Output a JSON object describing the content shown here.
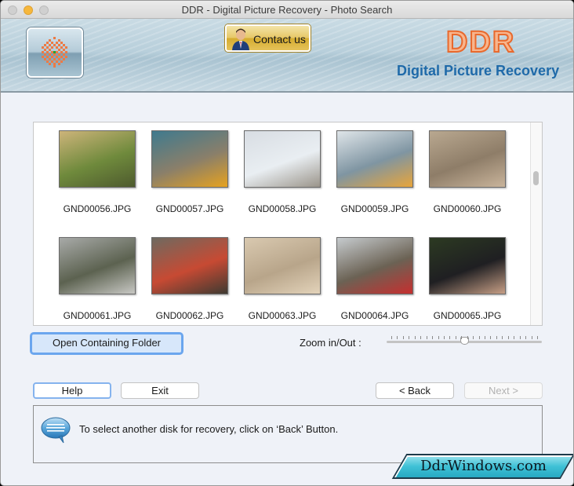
{
  "window": {
    "title": "DDR - Digital Picture Recovery - Photo Search"
  },
  "banner": {
    "contact_label": "Contact us",
    "brand": "DDR",
    "product": "Digital Picture Recovery",
    "brand_color": "#e8692d",
    "product_color": "#1f6aa9"
  },
  "gallery": {
    "items": [
      {
        "name": "GND00056.JPG",
        "colors": [
          "#cdb47a",
          "#6f8a3c",
          "#4e5a2e"
        ]
      },
      {
        "name": "GND00057.JPG",
        "colors": [
          "#3f7a8e",
          "#8a7f6a",
          "#e6a21f"
        ]
      },
      {
        "name": "GND00058.JPG",
        "colors": [
          "#d8dde3",
          "#e9eef2",
          "#9a948a"
        ]
      },
      {
        "name": "GND00059.JPG",
        "colors": [
          "#dfe5e9",
          "#7f95a2",
          "#e8a53b"
        ]
      },
      {
        "name": "GND00060.JPG",
        "colors": [
          "#b9a890",
          "#8e7d68",
          "#c9b49b"
        ]
      },
      {
        "name": "GND00061.JPG",
        "colors": [
          "#a8aaa8",
          "#5c6250",
          "#c8c8c4"
        ]
      },
      {
        "name": "GND00062.JPG",
        "colors": [
          "#6e6a60",
          "#c74a33",
          "#3e3a32"
        ]
      },
      {
        "name": "GND00063.JPG",
        "colors": [
          "#d9c9b0",
          "#b8a58a",
          "#e3d3ba"
        ]
      },
      {
        "name": "GND00064.JPG",
        "colors": [
          "#c6cbce",
          "#6b6254",
          "#c62f2f"
        ]
      },
      {
        "name": "GND00065.JPG",
        "colors": [
          "#2c3a22",
          "#1f1f22",
          "#c79f86"
        ]
      }
    ]
  },
  "controls": {
    "open_folder_label": "Open Containing Folder",
    "zoom_label": "Zoom in/Out :",
    "zoom_value_fraction": 0.5,
    "zoom_tick_count": 26
  },
  "nav": {
    "help_label": "Help",
    "exit_label": "Exit",
    "back_label": "< Back",
    "next_label": "Next >",
    "next_enabled": false
  },
  "info": {
    "message": "To select another disk for recovery, click on ‘Back’ Button."
  },
  "footer": {
    "site": "DdrWindows.com"
  }
}
